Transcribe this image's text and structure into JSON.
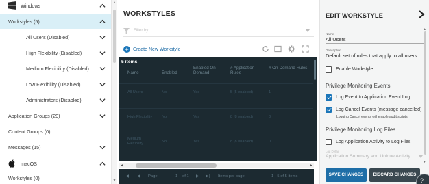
{
  "nav": {
    "items": [
      {
        "label": "Windows",
        "level": 0,
        "os": "windows",
        "chevron": "up",
        "selected": false
      },
      {
        "label": "Workstyles (5)",
        "level": 1,
        "chevron": "up",
        "selected": true
      },
      {
        "label": "All Users (Disabled)",
        "level": 2,
        "chevron": "down",
        "selected": false
      },
      {
        "label": "High Flexibility (Disabled)",
        "level": 2,
        "chevron": "down",
        "selected": false
      },
      {
        "label": "Medium Flexibility (Disabled)",
        "level": 2,
        "chevron": "down",
        "selected": false
      },
      {
        "label": "Low Flexibility (Disabled)",
        "level": 2,
        "chevron": "down",
        "selected": false
      },
      {
        "label": "Administrators (Disabled)",
        "level": 2,
        "chevron": "down",
        "selected": false
      },
      {
        "label": "Application Groups (20)",
        "level": 1,
        "chevron": "down",
        "selected": false
      },
      {
        "label": "Content Groups (0)",
        "level": 1,
        "chevron": "none",
        "selected": false
      },
      {
        "label": "Messages (15)",
        "level": 1,
        "chevron": "down",
        "selected": false
      },
      {
        "label": "macOS",
        "level": 0,
        "os": "apple",
        "chevron": "up",
        "selected": false
      },
      {
        "label": "Workstyles (0)",
        "level": 1,
        "chevron": "none",
        "selected": false
      }
    ]
  },
  "workstyles": {
    "title": "WORKSTYLES",
    "filter_placeholder": "Filter by",
    "create_label": "Create New Workstyle",
    "grid": {
      "count": "5 items",
      "columns": [
        "Name",
        "Enabled",
        "Enabled On-Demand",
        "# Application Rules",
        "# On-Demand Rules"
      ],
      "rows": [
        [
          "All Users",
          "No",
          "Yes",
          "5 (5 enabled)",
          "1"
        ],
        [
          "High Flexibility",
          "No",
          "Yes",
          "8 (8 enabled)",
          "0"
        ],
        [
          "Medium Flexibility",
          "No",
          "Yes",
          "8 (8 enabled)",
          "0"
        ]
      ]
    },
    "pager": {
      "page_label": "Page",
      "page_value": "1",
      "of_label": "of 1",
      "items_per_page": "Items per page",
      "range": "1 - 5 of 5 items"
    }
  },
  "edit": {
    "title": "EDIT WORKSTYLE",
    "name_label": "Name",
    "name_value": "All Users",
    "desc_label": "Description",
    "desc_value": "Default set of rules that apply to all users",
    "enable_label": "Enable Workstyle",
    "enable_checked": false,
    "pme_section": "Privilege Monitoring Events",
    "log_event_label": "Log Event to Application Event Log",
    "log_event_checked": true,
    "log_cancel_label": "Log Cancel Events (message cancelled)",
    "log_cancel_checked": true,
    "log_cancel_note": "Logging Cancel events will enable audit scripts",
    "pmlf_section": "Privilege Monitoring Log Files",
    "log_files_label": "Log Application Activity to Log Files",
    "log_files_checked": false,
    "log_detail_label": "Log Detail",
    "log_detail_value": "Application Summary and Unique Activity",
    "save_label": "SAVE CHANGES",
    "discard_label": "DISCARD CHANGES"
  },
  "colors": {
    "accent": "#1b76b9",
    "nav_selected": "#d9eff7",
    "grid_bg": "#1c2a31",
    "save_button": "#1e6ea7",
    "discard_button": "#3a4850"
  },
  "icons": {
    "windows": "windows-logo-icon",
    "apple": "apple-logo-icon",
    "filter": "filter-icon",
    "refresh": "refresh-icon",
    "columns": "columns-icon",
    "settings": "gear-icon",
    "fullscreen": "expand-icon",
    "close": "chevron-right-icon"
  }
}
